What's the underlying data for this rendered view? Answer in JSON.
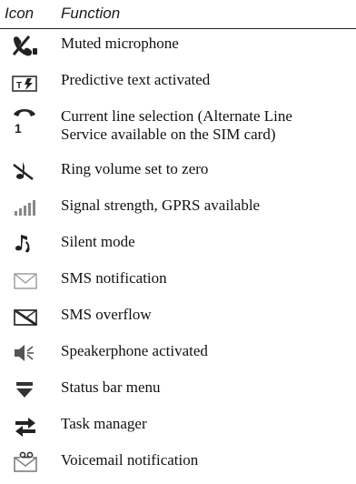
{
  "header": {
    "icon_col": "Icon",
    "function_col": "Function"
  },
  "rows": [
    {
      "icon": "muted-microphone-icon",
      "label": "Muted microphone"
    },
    {
      "icon": "predictive-text-icon",
      "label": "Predictive text activated"
    },
    {
      "icon": "current-line-icon",
      "label": "Current line selection (Alternate Line Service available on the SIM card)"
    },
    {
      "icon": "ring-volume-zero-icon",
      "label": "Ring volume set to zero"
    },
    {
      "icon": "signal-gprs-icon",
      "label": "Signal strength, GPRS available"
    },
    {
      "icon": "silent-mode-icon",
      "label": "Silent mode"
    },
    {
      "icon": "sms-notification-icon",
      "label": "SMS notification"
    },
    {
      "icon": "sms-overflow-icon",
      "label": "SMS overflow"
    },
    {
      "icon": "speakerphone-icon",
      "label": "Speakerphone activated"
    },
    {
      "icon": "status-bar-menu-icon",
      "label": "Status bar menu"
    },
    {
      "icon": "task-manager-icon",
      "label": "Task manager"
    },
    {
      "icon": "voicemail-icon",
      "label": "Voicemail notification"
    }
  ]
}
